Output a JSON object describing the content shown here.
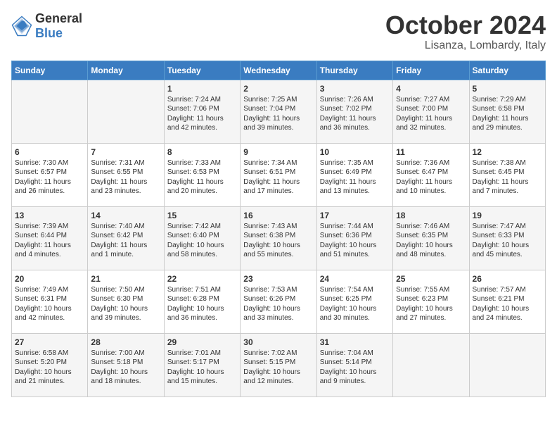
{
  "header": {
    "logo_general": "General",
    "logo_blue": "Blue",
    "month": "October 2024",
    "location": "Lisanza, Lombardy, Italy"
  },
  "weekdays": [
    "Sunday",
    "Monday",
    "Tuesday",
    "Wednesday",
    "Thursday",
    "Friday",
    "Saturday"
  ],
  "rows": [
    [
      {
        "day": "",
        "content": ""
      },
      {
        "day": "",
        "content": ""
      },
      {
        "day": "1",
        "content": "Sunrise: 7:24 AM\nSunset: 7:06 PM\nDaylight: 11 hours\nand 42 minutes."
      },
      {
        "day": "2",
        "content": "Sunrise: 7:25 AM\nSunset: 7:04 PM\nDaylight: 11 hours\nand 39 minutes."
      },
      {
        "day": "3",
        "content": "Sunrise: 7:26 AM\nSunset: 7:02 PM\nDaylight: 11 hours\nand 36 minutes."
      },
      {
        "day": "4",
        "content": "Sunrise: 7:27 AM\nSunset: 7:00 PM\nDaylight: 11 hours\nand 32 minutes."
      },
      {
        "day": "5",
        "content": "Sunrise: 7:29 AM\nSunset: 6:58 PM\nDaylight: 11 hours\nand 29 minutes."
      }
    ],
    [
      {
        "day": "6",
        "content": "Sunrise: 7:30 AM\nSunset: 6:57 PM\nDaylight: 11 hours\nand 26 minutes."
      },
      {
        "day": "7",
        "content": "Sunrise: 7:31 AM\nSunset: 6:55 PM\nDaylight: 11 hours\nand 23 minutes."
      },
      {
        "day": "8",
        "content": "Sunrise: 7:33 AM\nSunset: 6:53 PM\nDaylight: 11 hours\nand 20 minutes."
      },
      {
        "day": "9",
        "content": "Sunrise: 7:34 AM\nSunset: 6:51 PM\nDaylight: 11 hours\nand 17 minutes."
      },
      {
        "day": "10",
        "content": "Sunrise: 7:35 AM\nSunset: 6:49 PM\nDaylight: 11 hours\nand 13 minutes."
      },
      {
        "day": "11",
        "content": "Sunrise: 7:36 AM\nSunset: 6:47 PM\nDaylight: 11 hours\nand 10 minutes."
      },
      {
        "day": "12",
        "content": "Sunrise: 7:38 AM\nSunset: 6:45 PM\nDaylight: 11 hours\nand 7 minutes."
      }
    ],
    [
      {
        "day": "13",
        "content": "Sunrise: 7:39 AM\nSunset: 6:44 PM\nDaylight: 11 hours\nand 4 minutes."
      },
      {
        "day": "14",
        "content": "Sunrise: 7:40 AM\nSunset: 6:42 PM\nDaylight: 11 hours\nand 1 minute."
      },
      {
        "day": "15",
        "content": "Sunrise: 7:42 AM\nSunset: 6:40 PM\nDaylight: 10 hours\nand 58 minutes."
      },
      {
        "day": "16",
        "content": "Sunrise: 7:43 AM\nSunset: 6:38 PM\nDaylight: 10 hours\nand 55 minutes."
      },
      {
        "day": "17",
        "content": "Sunrise: 7:44 AM\nSunset: 6:36 PM\nDaylight: 10 hours\nand 51 minutes."
      },
      {
        "day": "18",
        "content": "Sunrise: 7:46 AM\nSunset: 6:35 PM\nDaylight: 10 hours\nand 48 minutes."
      },
      {
        "day": "19",
        "content": "Sunrise: 7:47 AM\nSunset: 6:33 PM\nDaylight: 10 hours\nand 45 minutes."
      }
    ],
    [
      {
        "day": "20",
        "content": "Sunrise: 7:49 AM\nSunset: 6:31 PM\nDaylight: 10 hours\nand 42 minutes."
      },
      {
        "day": "21",
        "content": "Sunrise: 7:50 AM\nSunset: 6:30 PM\nDaylight: 10 hours\nand 39 minutes."
      },
      {
        "day": "22",
        "content": "Sunrise: 7:51 AM\nSunset: 6:28 PM\nDaylight: 10 hours\nand 36 minutes."
      },
      {
        "day": "23",
        "content": "Sunrise: 7:53 AM\nSunset: 6:26 PM\nDaylight: 10 hours\nand 33 minutes."
      },
      {
        "day": "24",
        "content": "Sunrise: 7:54 AM\nSunset: 6:25 PM\nDaylight: 10 hours\nand 30 minutes."
      },
      {
        "day": "25",
        "content": "Sunrise: 7:55 AM\nSunset: 6:23 PM\nDaylight: 10 hours\nand 27 minutes."
      },
      {
        "day": "26",
        "content": "Sunrise: 7:57 AM\nSunset: 6:21 PM\nDaylight: 10 hours\nand 24 minutes."
      }
    ],
    [
      {
        "day": "27",
        "content": "Sunrise: 6:58 AM\nSunset: 5:20 PM\nDaylight: 10 hours\nand 21 minutes."
      },
      {
        "day": "28",
        "content": "Sunrise: 7:00 AM\nSunset: 5:18 PM\nDaylight: 10 hours\nand 18 minutes."
      },
      {
        "day": "29",
        "content": "Sunrise: 7:01 AM\nSunset: 5:17 PM\nDaylight: 10 hours\nand 15 minutes."
      },
      {
        "day": "30",
        "content": "Sunrise: 7:02 AM\nSunset: 5:15 PM\nDaylight: 10 hours\nand 12 minutes."
      },
      {
        "day": "31",
        "content": "Sunrise: 7:04 AM\nSunset: 5:14 PM\nDaylight: 10 hours\nand 9 minutes."
      },
      {
        "day": "",
        "content": ""
      },
      {
        "day": "",
        "content": ""
      }
    ]
  ]
}
